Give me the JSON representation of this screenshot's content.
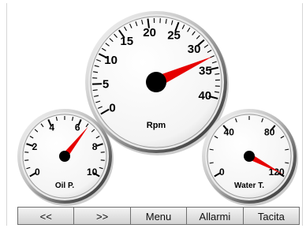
{
  "gauges": {
    "rpm": {
      "label": "Rpm",
      "ticks": [
        "0",
        "5",
        "10",
        "15",
        "20",
        "25",
        "30",
        "35",
        "40"
      ],
      "value": 33,
      "needle_color": "#e60000"
    },
    "oil": {
      "label": "Oil P.",
      "ticks": [
        "0",
        "2",
        "4",
        "6",
        "8",
        "10"
      ],
      "value": 6.6,
      "needle_color": "#e60000"
    },
    "water": {
      "label": "Water T.",
      "ticks": [
        "0",
        "40",
        "80",
        "120"
      ],
      "value": 119,
      "needle_color": "#e60000"
    }
  },
  "toolbar": {
    "prev_label": "<<",
    "next_label": ">>",
    "menu_label": "Menu",
    "alarms_label": "Allarmi",
    "silence_label": "Tacita"
  }
}
